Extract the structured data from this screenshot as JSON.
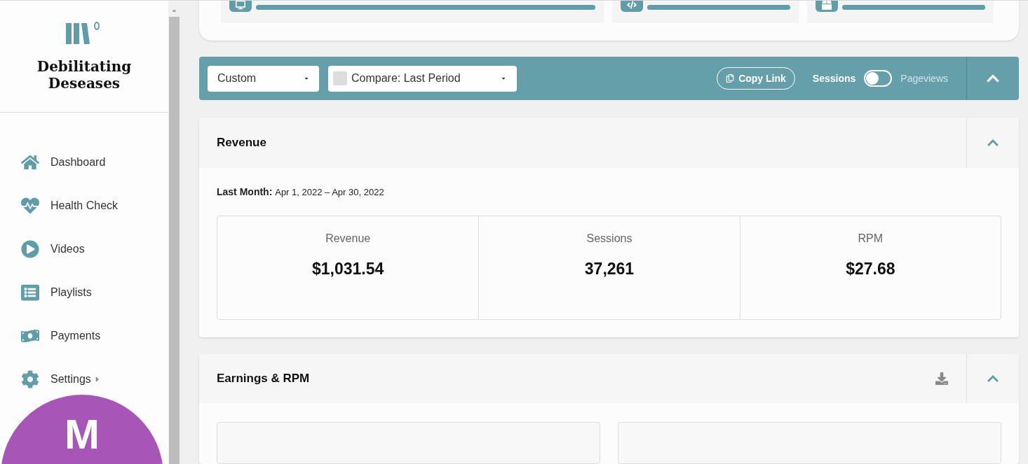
{
  "sidebar": {
    "brand": "Debilitating Deseases",
    "items": [
      {
        "label": "Dashboard",
        "submenu": false
      },
      {
        "label": "Health Check",
        "submenu": false
      },
      {
        "label": "Videos",
        "submenu": false
      },
      {
        "label": "Playlists",
        "submenu": false
      },
      {
        "label": "Payments",
        "submenu": false
      },
      {
        "label": "Settings",
        "submenu": true
      }
    ],
    "avatar": {
      "initial": "M",
      "color": "#a855b8"
    }
  },
  "top_cards": [
    {
      "level": 1
    },
    {
      "level": 1
    },
    {
      "level": 1
    }
  ],
  "filter_bar": {
    "range": "Custom",
    "compare": "Compare: Last Period",
    "compare_checked": false,
    "copy_link": "Copy Link",
    "toggle_left": "Sessions",
    "toggle_right": "Pageviews",
    "toggle_on": false
  },
  "revenue": {
    "title": "Revenue",
    "period_label": "Last Month:",
    "period": "Apr 1, 2022 – Apr 30, 2022",
    "expanded": true,
    "stats": [
      {
        "label": "Revenue",
        "value": "$1,031.54"
      },
      {
        "label": "Sessions",
        "value": "37,261"
      },
      {
        "label": "RPM",
        "value": "$27.68"
      }
    ]
  },
  "earnings": {
    "title": "Earnings & RPM",
    "expanded": true
  }
}
